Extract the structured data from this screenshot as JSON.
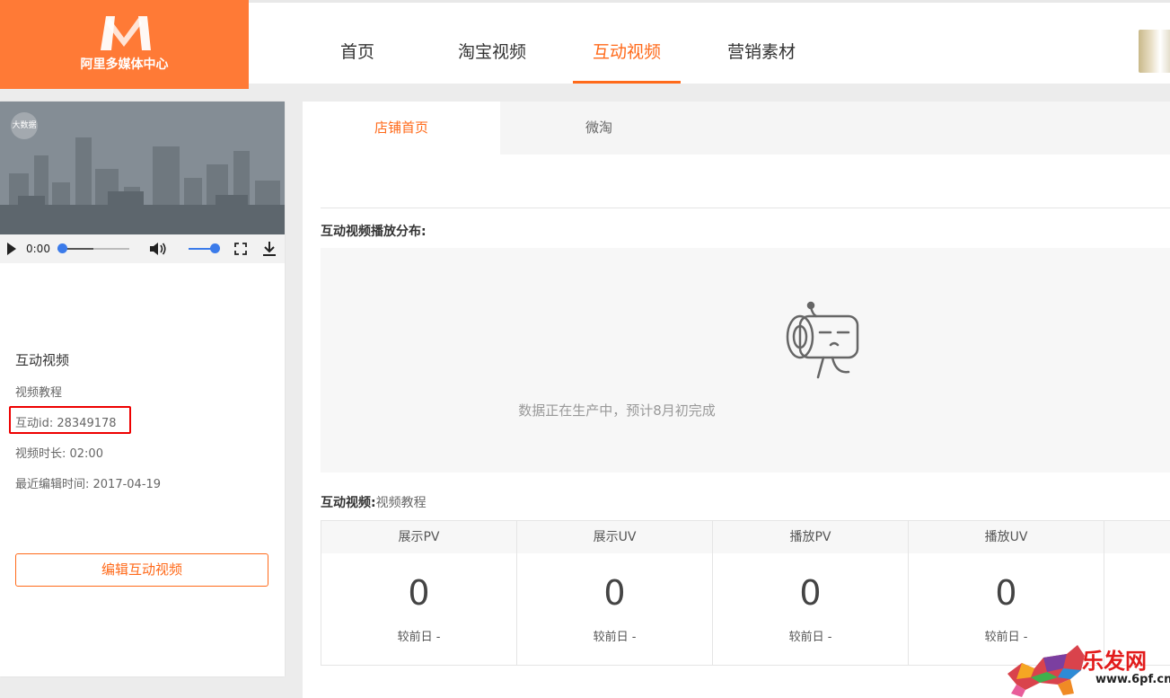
{
  "brand": {
    "name": "阿里多媒体中心",
    "color": "#ff7a36"
  },
  "nav": {
    "items": [
      {
        "label": "首页",
        "active": false
      },
      {
        "label": "淘宝视频",
        "active": false
      },
      {
        "label": "互动视频",
        "active": true
      },
      {
        "label": "营销素材",
        "active": false
      }
    ],
    "accent": "#ff6a1a"
  },
  "player": {
    "thumbnail_badge": "大数据",
    "time": "0:00",
    "progress": 0,
    "volume": 1.0
  },
  "video_info": {
    "category": "互动视频",
    "title": "视频教程",
    "id_line": "互动id: 28349178",
    "duration_line": "视频时长: 02:00",
    "edited_line": "最近编辑时间: 2017-04-19",
    "edit_button": "编辑互动视频"
  },
  "tabs": [
    {
      "label": "店铺首页",
      "active": true
    },
    {
      "label": "微淘",
      "active": false
    }
  ],
  "distribution": {
    "title": "互动视频播放分布:",
    "empty_message": "数据正在生产中，预计8月初完成"
  },
  "stats_section": {
    "title": "互动视频:",
    "subtitle": "视频教程",
    "columns": [
      {
        "header": "展示PV",
        "value": "0",
        "compare": "较前日 -"
      },
      {
        "header": "展示UV",
        "value": "0",
        "compare": "较前日 -"
      },
      {
        "header": "播放PV",
        "value": "0",
        "compare": "较前日 -"
      },
      {
        "header": "播放UV",
        "value": "0",
        "compare": "较前日 -"
      }
    ]
  },
  "watermark": {
    "brand": "乐发网",
    "url": "www.6pf.cn"
  }
}
